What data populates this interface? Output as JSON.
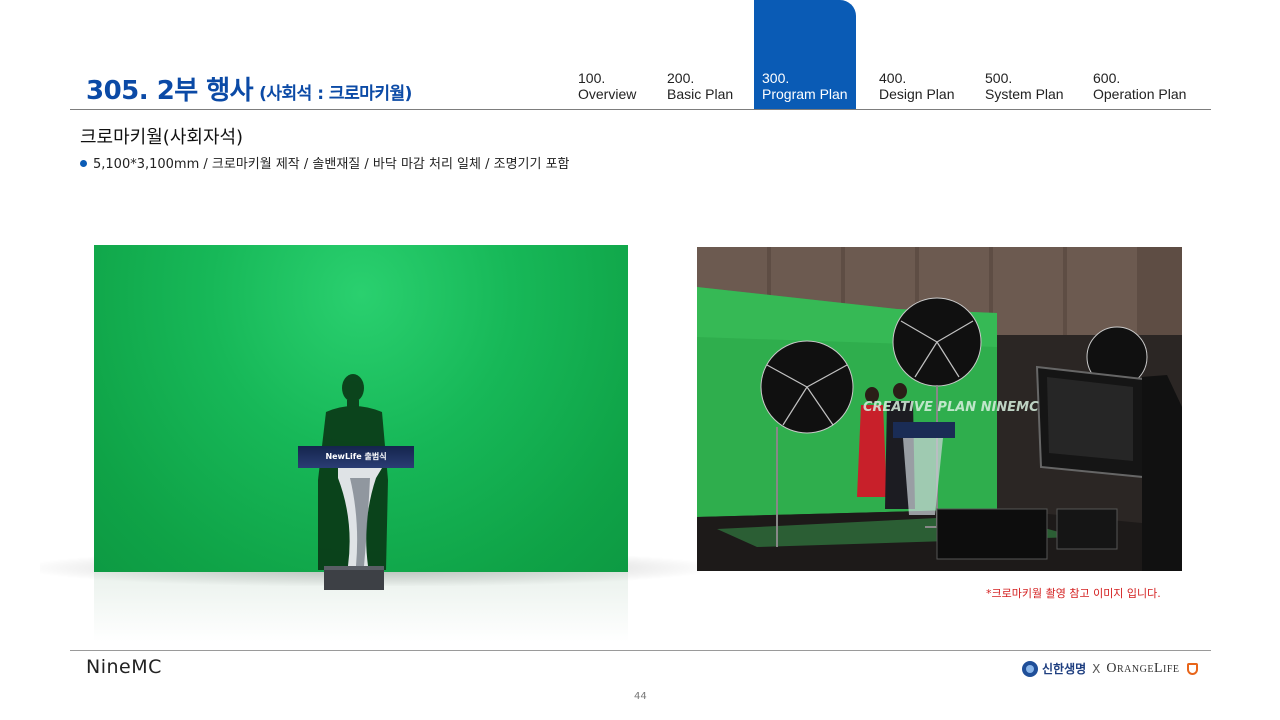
{
  "header": {
    "title": "305. 2부 행사",
    "subtitle": "(사회석 : 크로마키월)",
    "tabs": [
      {
        "num": "100.",
        "label": "Overview",
        "active": false
      },
      {
        "num": "200.",
        "label": "Basic Plan",
        "active": false
      },
      {
        "num": "300.",
        "label": "Program Plan",
        "active": true
      },
      {
        "num": "400.",
        "label": "Design Plan",
        "active": false
      },
      {
        "num": "500.",
        "label": "System Plan",
        "active": false
      },
      {
        "num": "600.",
        "label": "Operation Plan",
        "active": false
      }
    ]
  },
  "content": {
    "section_title": "크로마키월(사회자석)",
    "bullet": "5,100*3,100mm / 크로마키월 제작 / 솔밴재질 / 바닥 마감 처리 일체 / 조명기기 포함",
    "podium_banner": "NewLife 출범식",
    "photo_overlay_text": "CREATIVE PLAN NINEMC",
    "caption": "*크로마키월 촬영 참고 이미지 입니다."
  },
  "footer": {
    "logo_left": "NineMC",
    "logo_right_a": "신한생명",
    "logo_right_x": "X",
    "logo_right_b": "OrangeLife",
    "page_number": "44"
  },
  "colors": {
    "accent": "#0a5bb5",
    "title": "#0b4aa6",
    "chroma_green": "#17b858",
    "caption_red": "#d42020"
  }
}
